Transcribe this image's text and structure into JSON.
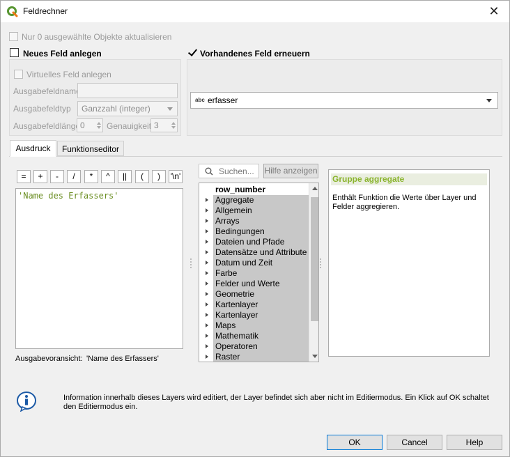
{
  "window": {
    "title": "Feldrechner"
  },
  "top": {
    "only_selected": "Nur 0 ausgewählte Objekte aktualisieren",
    "new_field": "Neues Feld anlegen",
    "update_field": "Vorhandenes Feld erneuern",
    "virtual_field": "Virtuelles Feld anlegen",
    "out_name_label": "Ausgabefeldname",
    "out_type_label": "Ausgabefeldtyp",
    "out_type_value": "Ganzzahl (integer)",
    "out_length_label": "Ausgabefeldlänge",
    "out_length_value": "0",
    "precision_label": "Genauigkeit",
    "precision_value": "3",
    "existing_field_type": "abc",
    "existing_field_value": "erfasser"
  },
  "tabs": [
    {
      "label": "Ausdruck",
      "active": true
    },
    {
      "label": "Funktionseditor",
      "active": false
    }
  ],
  "operators": [
    "=",
    "+",
    "-",
    "/",
    "*",
    "^",
    "||",
    "(",
    ")",
    "'\\n'"
  ],
  "expression": "'Name des Erfassers'",
  "preview": {
    "label": "Ausgabevoransicht:",
    "value": "'Name des Erfassers'"
  },
  "search": {
    "placeholder": "Suchen..."
  },
  "show_help_label": "Hilfe anzeigen",
  "functions": [
    {
      "label": "row_number",
      "expandable": false,
      "bold": true
    },
    {
      "label": "Aggregate",
      "expandable": true
    },
    {
      "label": "Allgemein",
      "expandable": true
    },
    {
      "label": "Arrays",
      "expandable": true
    },
    {
      "label": "Bedingungen",
      "expandable": true
    },
    {
      "label": "Dateien und Pfade",
      "expandable": true
    },
    {
      "label": "Datensätze und Attribute",
      "expandable": true
    },
    {
      "label": "Datum und Zeit",
      "expandable": true
    },
    {
      "label": "Farbe",
      "expandable": true
    },
    {
      "label": "Felder und Werte",
      "expandable": true
    },
    {
      "label": "Geometrie",
      "expandable": true
    },
    {
      "label": "Kartenlayer",
      "expandable": true
    },
    {
      "label": "Kartenlayer",
      "expandable": true
    },
    {
      "label": "Maps",
      "expandable": true
    },
    {
      "label": "Mathematik",
      "expandable": true
    },
    {
      "label": "Operatoren",
      "expandable": true
    },
    {
      "label": "Raster",
      "expandable": true
    }
  ],
  "help": {
    "title": "Gruppe aggregate",
    "body": "Enthält Funktion die Werte über Layer und Felder aggregieren."
  },
  "info": "Information innerhalb dieses Layers wird editiert, der Layer befindet sich aber nicht im Editiermodus. Ein Klick auf OK schaltet den Editiermodus ein.",
  "buttons": {
    "ok": "OK",
    "cancel": "Cancel",
    "help": "Help"
  },
  "colors": {
    "qgis_green": "#589632",
    "help_title": "#8ab42d",
    "expression_text": "#6b8e23",
    "info_blue": "#1c5aa6"
  }
}
